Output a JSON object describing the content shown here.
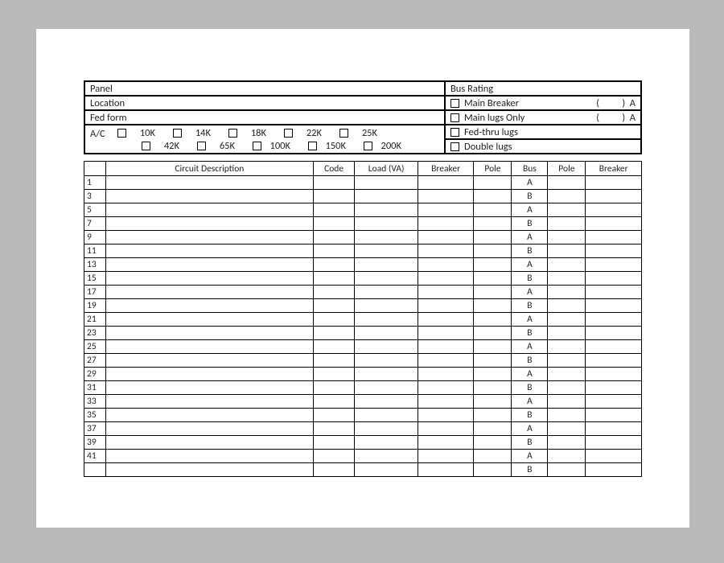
{
  "header": {
    "panel_label": "Panel",
    "bus_rating_label": "Bus Rating",
    "location_label": "Location",
    "fed_form_label": "Fed form",
    "main_breaker_label": "Main Breaker",
    "main_lugs_label": "Main lugs Only",
    "amp_open": "(",
    "amp_close": ")",
    "amp_unit": "A",
    "fed_thru_label": "Fed-thru lugs",
    "double_lugs_label": "Double lugs",
    "ac_label": "A/C",
    "ac_options_row1": [
      "10K",
      "14K",
      "18K",
      "22K",
      "25K"
    ],
    "ac_options_row2": [
      "42K",
      "65K",
      "100K",
      "150K",
      "200K"
    ]
  },
  "columns": {
    "num": "",
    "desc": "Circuit Description",
    "code": "Code",
    "load": "Load (VA)",
    "breaker": "Breaker",
    "pole": "Pole",
    "bus": "Bus",
    "pole2": "Pole",
    "breaker2": "Breaker"
  },
  "rows": [
    {
      "n": "1",
      "bus": "A"
    },
    {
      "n": "3",
      "bus": "B"
    },
    {
      "n": "5",
      "bus": "A"
    },
    {
      "n": "7",
      "bus": "B"
    },
    {
      "n": "9",
      "bus": "A"
    },
    {
      "n": "11",
      "bus": "B"
    },
    {
      "n": "13",
      "bus": "A"
    },
    {
      "n": "15",
      "bus": "B"
    },
    {
      "n": "17",
      "bus": "A"
    },
    {
      "n": "19",
      "bus": "B"
    },
    {
      "n": "21",
      "bus": "A"
    },
    {
      "n": "23",
      "bus": "B"
    },
    {
      "n": "25",
      "bus": "A"
    },
    {
      "n": "27",
      "bus": "B"
    },
    {
      "n": "29",
      "bus": "A"
    },
    {
      "n": "31",
      "bus": "B"
    },
    {
      "n": "33",
      "bus": "A"
    },
    {
      "n": "35",
      "bus": "B"
    },
    {
      "n": "37",
      "bus": "A"
    },
    {
      "n": "39",
      "bus": "B"
    },
    {
      "n": "41",
      "bus": "A"
    },
    {
      "n": "",
      "bus": "B"
    }
  ]
}
